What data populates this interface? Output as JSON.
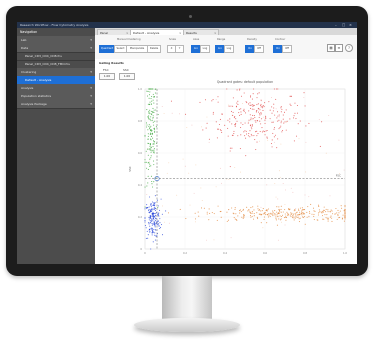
{
  "app": {
    "title": "Research Workflow - Flow Cytometry Analysis",
    "window_controls": [
      "–",
      "□",
      "×"
    ]
  },
  "sidebar": {
    "title": "Navigation",
    "items": [
      {
        "label": "Lab",
        "kind": "group"
      },
      {
        "label": "Data",
        "kind": "group"
      },
      {
        "label": "Panel_CD3_CD4_CD8.fcs",
        "kind": "item"
      },
      {
        "label": "Panel_CD3_CD4_CD8_FMO.fcs",
        "kind": "item"
      },
      {
        "label": "Clustering",
        "kind": "group"
      },
      {
        "label": "Default - Analysis",
        "kind": "active"
      },
      {
        "label": "Analysis",
        "kind": "group"
      },
      {
        "label": "Population statistics",
        "kind": "group"
      },
      {
        "label": "Analysis Package",
        "kind": "group"
      }
    ]
  },
  "tabs": [
    {
      "label": "Panel"
    },
    {
      "label": "Default - Analysis"
    },
    {
      "label": "Results"
    }
  ],
  "toolbar": {
    "group_label": "Manual Clustering",
    "buttons": [
      "Quadrant",
      "Select",
      "Manipulate",
      "Delete"
    ],
    "label_scale": "Scale",
    "label_axes": "Axes",
    "label_range": "Range",
    "label_density": "Density",
    "label_contour": "Contour",
    "small_buttons": [
      "X",
      "Y",
      "Lin",
      "Log",
      "Lin",
      "Log",
      "On",
      "Off",
      "On",
      "Off"
    ]
  },
  "content": {
    "section_title": "Gating Results",
    "gate_headers": [
      "FSC",
      "SSC"
    ],
    "gate_values": [
      "1.00",
      "1.00"
    ]
  },
  "chart_data": {
    "type": "scatter",
    "title": "Quadrant gates: default population",
    "xlabel": "FSC",
    "ylabel": "SSC",
    "xlim": [
      0,
      1
    ],
    "ylim": [
      0,
      1
    ],
    "xticks": [
      "0",
      "0.2",
      "0.4",
      "0.6",
      "0.8",
      "1.0"
    ],
    "yticks": [
      "0",
      "0.2",
      "0.4",
      "0.6",
      "0.8",
      "1.0"
    ],
    "grid": true,
    "quadrant_gate": {
      "x": 0.06,
      "y": 0.44
    },
    "clusters": [
      {
        "color": "#dd3b3b",
        "center": [
          0.55,
          0.82
        ],
        "spread": [
          0.12,
          0.09
        ],
        "points": 260
      },
      {
        "color": "#2fa02f",
        "center": [
          0.03,
          0.72
        ],
        "spread": [
          0.015,
          0.18
        ],
        "points": 160
      },
      {
        "color": "#1f3fd8",
        "center": [
          0.04,
          0.19
        ],
        "spread": [
          0.02,
          0.06
        ],
        "points": 180
      },
      {
        "color": "#e07d2c",
        "center": [
          0.7,
          0.22
        ],
        "spread": [
          0.2,
          0.025
        ],
        "points": 300
      }
    ]
  }
}
